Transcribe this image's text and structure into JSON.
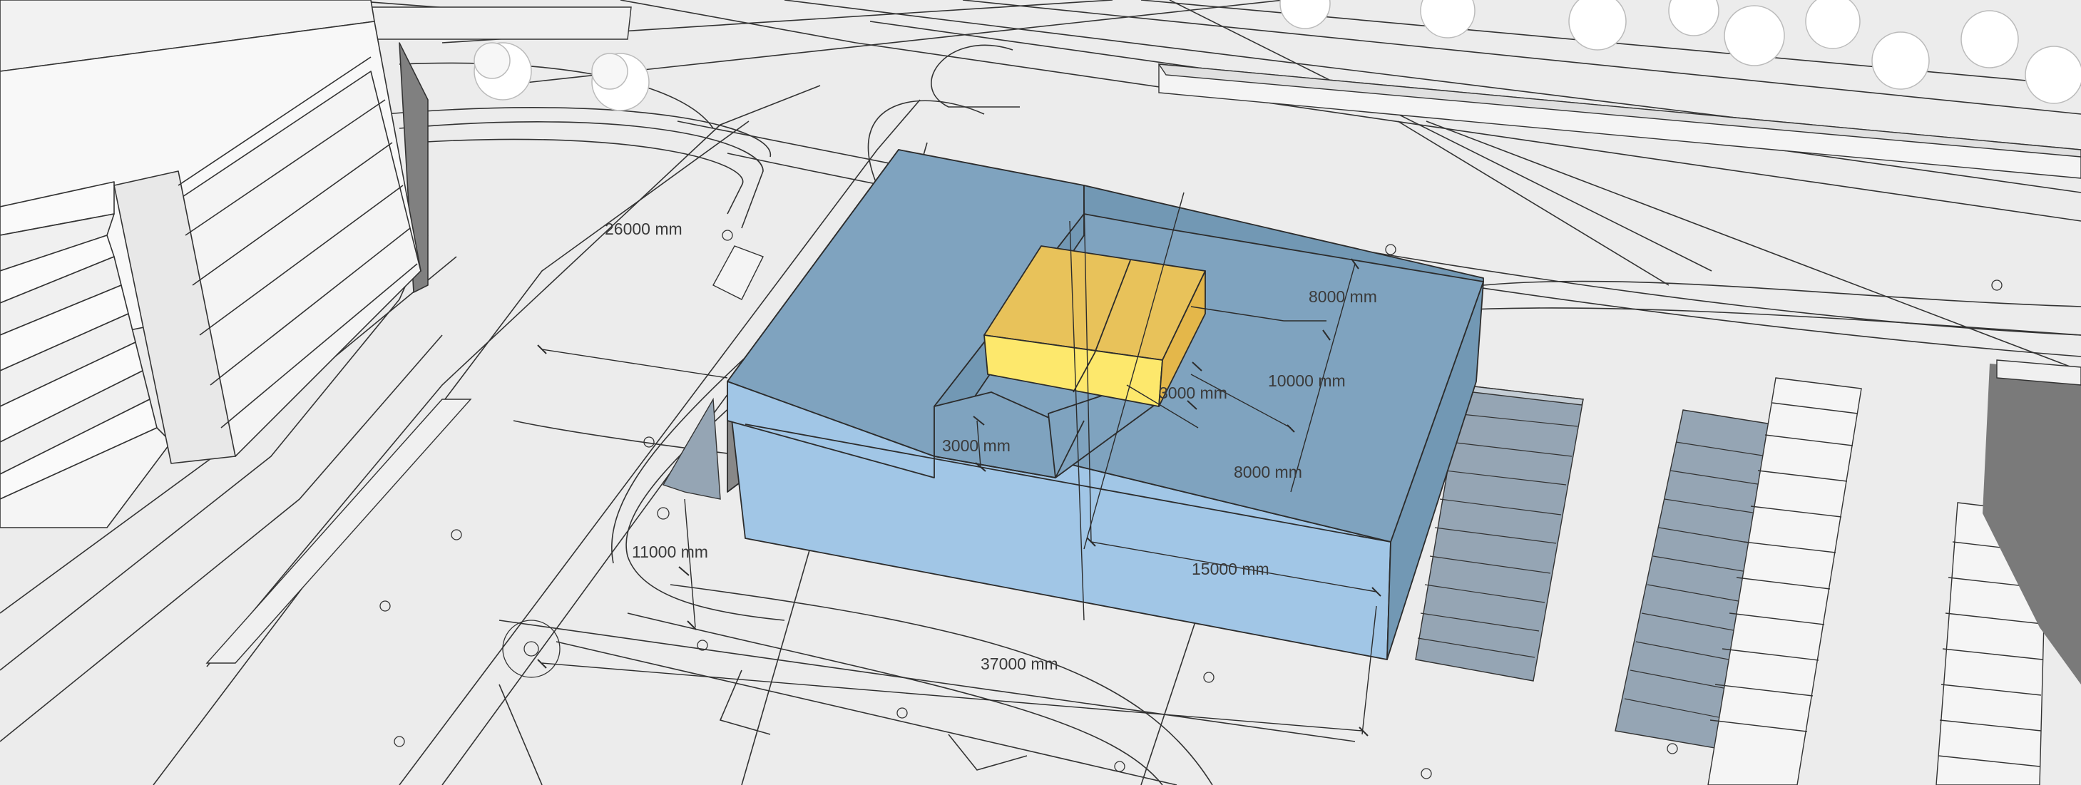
{
  "dimensions": {
    "d26000": "26000 mm",
    "d8000_top": "8000 mm",
    "d10000": "10000 mm",
    "d3000_upper": "3000 mm",
    "d3000_lower": "3000 mm",
    "d8000_side": "8000 mm",
    "d11000": "11000 mm",
    "d15000": "15000 mm",
    "d37000": "37000 mm"
  },
  "colors": {
    "background": "#ececec",
    "building_top": "#7fa3bf",
    "building_front": "#a1c6e6",
    "building_side": "#7298b4",
    "volume_top": "#e8c25a",
    "volume_front": "#fde86c",
    "volume_side": "#e4b74a",
    "parking": "#95a5b4",
    "tree": "#ffffff",
    "context_wall": "#f5f5f5"
  }
}
